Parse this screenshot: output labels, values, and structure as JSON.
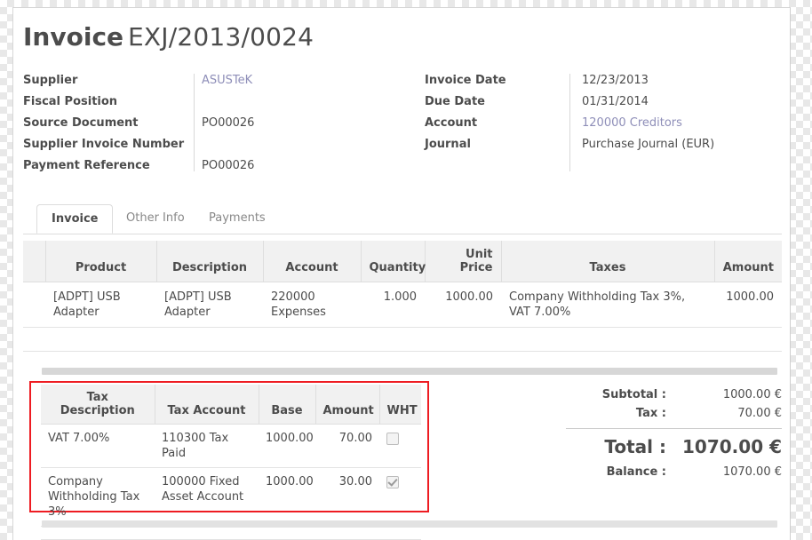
{
  "document": {
    "title_prefix": "Invoice",
    "title_number": "EXJ/2013/0024"
  },
  "header": {
    "left_fields": [
      {
        "label": "Supplier",
        "value": "ASUSTeK",
        "is_link": true
      },
      {
        "label": "Fiscal Position",
        "value": "",
        "is_link": false
      },
      {
        "label": "Source Document",
        "value": "PO00026",
        "is_link": false
      },
      {
        "label": "Supplier Invoice Number",
        "value": "",
        "is_link": false
      },
      {
        "label": "Payment Reference",
        "value": "PO00026",
        "is_link": false
      }
    ],
    "right_fields": [
      {
        "label": "Invoice Date",
        "value": "12/23/2013",
        "is_link": false
      },
      {
        "label": "Due Date",
        "value": "01/31/2014",
        "is_link": false
      },
      {
        "label": "Account",
        "value": "120000 Creditors",
        "is_link": true
      },
      {
        "label": "Journal",
        "value": "Purchase Journal (EUR)",
        "is_link": false
      }
    ]
  },
  "tabs": [
    {
      "label": "Invoice",
      "active": true
    },
    {
      "label": "Other Info",
      "active": false
    },
    {
      "label": "Payments",
      "active": false
    }
  ],
  "lines_table": {
    "columns": [
      "Product",
      "Description",
      "Account",
      "Quantity",
      "Unit Price",
      "Taxes",
      "Amount"
    ],
    "rows": [
      {
        "product": "[ADPT] USB Adapter",
        "description": "[ADPT] USB Adapter",
        "account": "220000 Expenses",
        "quantity": "1.000",
        "unit_price": "1000.00",
        "taxes": "Company Withholding Tax 3%, VAT 7.00%",
        "amount": "1000.00"
      }
    ]
  },
  "tax_table": {
    "columns": [
      "Tax Description",
      "Tax Account",
      "Base",
      "Amount",
      "WHT"
    ],
    "rows": [
      {
        "description": "VAT 7.00%",
        "account": "110300 Tax Paid",
        "base": "1000.00",
        "amount": "70.00",
        "wht": false
      },
      {
        "description": "Company Withholding Tax 3%",
        "account": "100000 Fixed Asset Account",
        "base": "1000.00",
        "amount": "30.00",
        "wht": true
      }
    ],
    "highlight_color": "#ee1c22"
  },
  "totals": {
    "subtotal_label": "Subtotal :",
    "subtotal_value": "1000.00 €",
    "tax_label": "Tax :",
    "tax_value": "70.00 €",
    "total_label": "Total :",
    "total_value": "1070.00 €",
    "balance_label": "Balance :",
    "balance_value": "1070.00 €"
  },
  "colors": {
    "link": "#8e8eb8",
    "text": "#4c4c4c",
    "header_bg": "#f1f1f1",
    "highlight": "#ee1c22"
  }
}
